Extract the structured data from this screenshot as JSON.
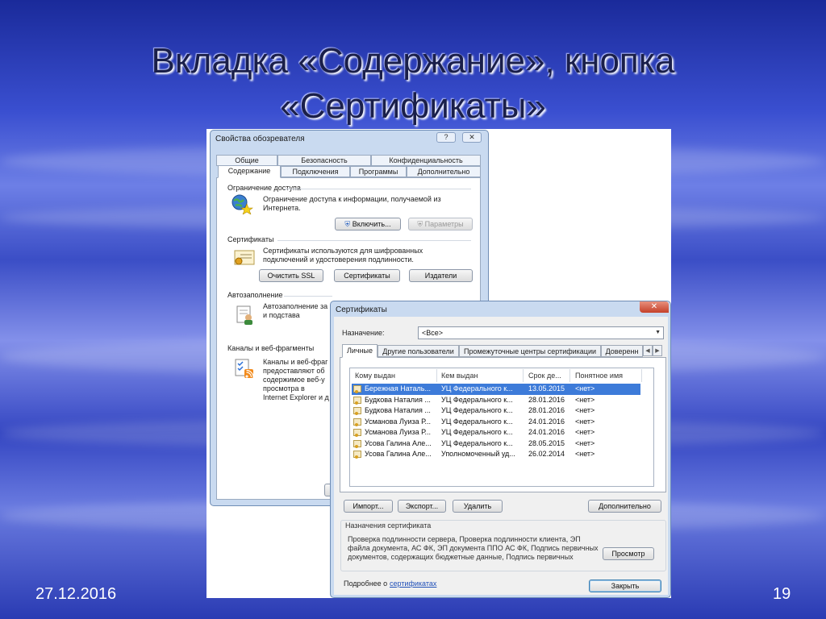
{
  "slide": {
    "title_line1": "Вкладка «Содержание», кнопка",
    "title_line2": "«Сертификаты»",
    "date": "27.12.2016",
    "page_number": "19"
  },
  "browser_properties": {
    "title": "Свойства обозревателя",
    "help_btn": "?",
    "close_btn": "✕",
    "tabs_row1": [
      "Общие",
      "Безопасность",
      "Конфиденциальность"
    ],
    "tabs_row2": [
      "Содержание",
      "Подключения",
      "Программы",
      "Дополнительно"
    ],
    "active_tab": "Содержание",
    "access": {
      "heading": "Ограничение доступа",
      "text1": "Ограничение доступа к информации, получаемой из",
      "text2": "Интернета.",
      "enable_btn": "Включить...",
      "params_btn": "Параметры"
    },
    "certificates": {
      "heading": "Сертификаты",
      "text1": "Сертификаты используются для шифрованных",
      "text2": "подключений и удостоверения подлинности.",
      "clear_ssl_btn": "Очистить SSL",
      "certs_btn": "Сертификаты",
      "publishers_btn": "Издатели"
    },
    "autofill": {
      "heading": "Автозаполнение",
      "text1": "Автозаполнение за",
      "text2": "и подстава"
    },
    "feeds": {
      "heading": "Каналы и веб-фрагменты",
      "text1": "Каналы и веб-фраг",
      "text2": "предоставляют об",
      "text3": "содержимое веб-у",
      "text4": "просмотра в",
      "text5": "Internet Explorer и д"
    }
  },
  "certificates_dialog": {
    "title": "Сертификаты",
    "close_btn": "✕",
    "purpose_label": "Назначение:",
    "purpose_value": "<Все>",
    "tabs": [
      "Личные",
      "Другие пользователи",
      "Промежуточные центры сертификации",
      "Доверенн"
    ],
    "active_tab": "Личные",
    "columns": [
      "Кому выдан",
      "Кем выдан",
      "Срок де...",
      "Понятное имя"
    ],
    "rows": [
      {
        "to": "Бережная Наталь...",
        "by": "УЦ Федерального к...",
        "exp": "13.05.2015",
        "name": "<нет>",
        "selected": true
      },
      {
        "to": "Будкова Наталия ...",
        "by": "УЦ Федерального к...",
        "exp": "28.01.2016",
        "name": "<нет>",
        "selected": false
      },
      {
        "to": "Будкова Наталия ...",
        "by": "УЦ Федерального к...",
        "exp": "28.01.2016",
        "name": "<нет>",
        "selected": false
      },
      {
        "to": "Усманова Луиза Р...",
        "by": "УЦ Федерального к...",
        "exp": "24.01.2016",
        "name": "<нет>",
        "selected": false
      },
      {
        "to": "Усманова Луиза Р...",
        "by": "УЦ Федерального к...",
        "exp": "24.01.2016",
        "name": "<нет>",
        "selected": false
      },
      {
        "to": "Усова Галина Але...",
        "by": "УЦ Федерального к...",
        "exp": "28.05.2015",
        "name": "<нет>",
        "selected": false
      },
      {
        "to": "Усова Галина Але...",
        "by": "Уполномоченный уд...",
        "exp": "26.02.2014",
        "name": "<нет>",
        "selected": false
      }
    ],
    "import_btn": "Импорт...",
    "export_btn": "Экспорт...",
    "delete_btn": "Удалить",
    "advanced_btn": "Дополнительно",
    "purposes_heading": "Назначения сертификата",
    "purposes_text1": "Проверка подлинности сервера, Проверка подлинности клиента, ЭП",
    "purposes_text2": "файла документа, АС ФК, ЭП документа ППО АС ФК, Подпись первичных",
    "purposes_text3": "документов, содержащих бюджетные данные, Подпись первичных",
    "view_btn": "Просмотр",
    "more_text": "Подробнее о",
    "more_link": "сертификатах",
    "close_dialog_btn": "Закрыть"
  }
}
